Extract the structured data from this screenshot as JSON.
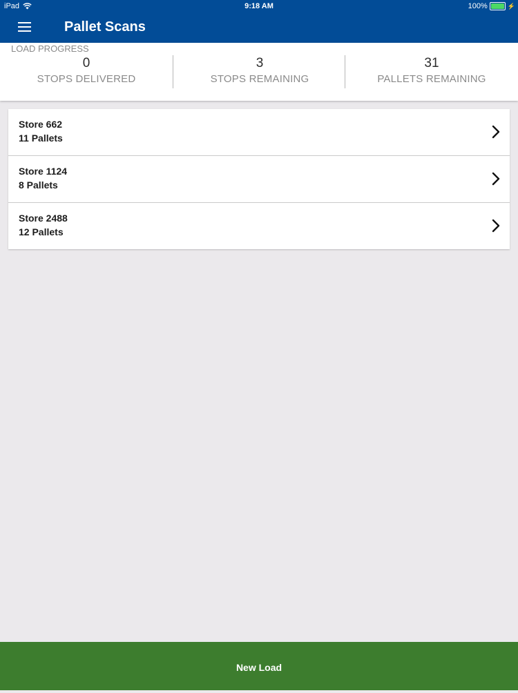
{
  "status_bar": {
    "device": "iPad",
    "time": "9:18 AM",
    "battery": "100%"
  },
  "app_bar": {
    "title": "Pallet Scans"
  },
  "load_progress": {
    "label": "LOAD PROGRESS",
    "stats": [
      {
        "value": "0",
        "label": "STOPS DELIVERED"
      },
      {
        "value": "3",
        "label": "STOPS REMAINING"
      },
      {
        "value": "31",
        "label": "PALLETS REMAINING"
      }
    ]
  },
  "stores": [
    {
      "name": "Store 662",
      "pallets": "11 Pallets"
    },
    {
      "name": "Store 1124",
      "pallets": "8 Pallets"
    },
    {
      "name": "Store 2488",
      "pallets": "12 Pallets"
    }
  ],
  "footer": {
    "new_load_label": "New Load"
  },
  "colors": {
    "header_blue": "#024c97",
    "footer_green": "#3d7d2e",
    "background": "#ebe9ec",
    "battery_green": "#4cd964"
  },
  "icons": [
    "wifi-icon",
    "battery-icon",
    "menu-icon",
    "chevron-right-icon"
  ]
}
